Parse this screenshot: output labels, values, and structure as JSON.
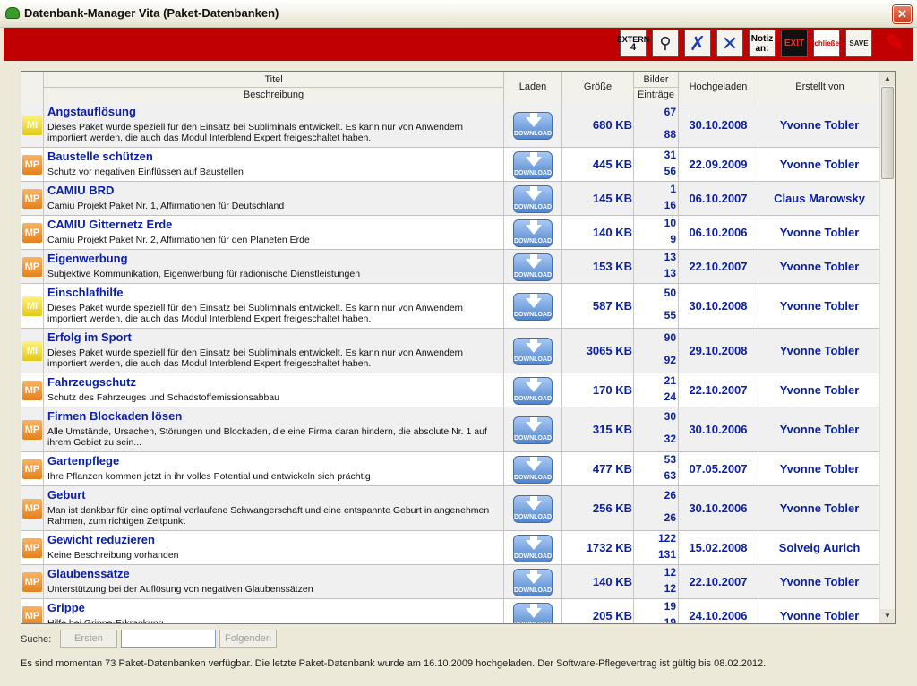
{
  "window": {
    "title": "Datenbank-Manager Vita (Paket-Datenbanken)",
    "close": "✕"
  },
  "toolbar": {
    "extern_label": "EXTERN",
    "extern_num": "4",
    "notiz_label": "Notiz an:",
    "exit_label": "EXIT",
    "schliessen_label": "Schließen",
    "save_label": "SAVE"
  },
  "columns": {
    "titel": "Titel",
    "beschreibung": "Beschreibung",
    "laden": "Laden",
    "groesse": "Größe",
    "bilder": "Bilder",
    "eintraege": "Einträge",
    "hochgeladen": "Hochgeladen",
    "erstellt_von": "Erstellt von"
  },
  "download_label": "DOWNLOAD",
  "rows": [
    {
      "badge": "MI",
      "title": "Angstauflösung",
      "desc": "Dieses Paket wurde speziell für den Einsatz bei Subliminals entwickelt. Es kann nur von Anwendern importiert werden, die auch das Modul Interblend Expert freigeschaltet haben.",
      "size": "680 KB",
      "bilder": "67",
      "eintraege": "88",
      "date": "30.10.2008",
      "author": "Yvonne Tobler"
    },
    {
      "badge": "MP",
      "title": "Baustelle schützen",
      "desc": "Schutz vor negativen Einflüssen auf Baustellen",
      "size": "445 KB",
      "bilder": "31",
      "eintraege": "56",
      "date": "22.09.2009",
      "author": "Yvonne Tobler"
    },
    {
      "badge": "MP",
      "title": "CAMIU BRD",
      "desc": "Camiu Projekt Paket Nr. 1, Affirmationen für Deutschland",
      "size": "145 KB",
      "bilder": "1",
      "eintraege": "16",
      "date": "06.10.2007",
      "author": "Claus Marowsky"
    },
    {
      "badge": "MP",
      "title": "CAMIU Gitternetz Erde",
      "desc": "Camiu Projekt Paket Nr. 2, Affirmationen für den Planeten Erde",
      "size": "140 KB",
      "bilder": "10",
      "eintraege": "9",
      "date": "06.10.2006",
      "author": "Yvonne Tobler"
    },
    {
      "badge": "MP",
      "title": "Eigenwerbung",
      "desc": "Subjektive Kommunikation, Eigenwerbung für radionische Dienstleistungen",
      "size": "153 KB",
      "bilder": "13",
      "eintraege": "13",
      "date": "22.10.2007",
      "author": "Yvonne Tobler"
    },
    {
      "badge": "MI",
      "title": "Einschlafhilfe",
      "desc": "Dieses Paket wurde speziell für den Einsatz bei Subliminals entwickelt. Es kann nur von Anwendern importiert werden, die auch das Modul Interblend Expert freigeschaltet haben.",
      "size": "587 KB",
      "bilder": "50",
      "eintraege": "55",
      "date": "30.10.2008",
      "author": "Yvonne Tobler"
    },
    {
      "badge": "MI",
      "title": "Erfolg im Sport",
      "desc": "Dieses Paket wurde speziell für den Einsatz bei Subliminals entwickelt. Es kann nur von Anwendern importiert werden, die auch das Modul Interblend Expert freigeschaltet haben.",
      "size": "3065 KB",
      "bilder": "90",
      "eintraege": "92",
      "date": "29.10.2008",
      "author": "Yvonne Tobler"
    },
    {
      "badge": "MP",
      "title": "Fahrzeugschutz",
      "desc": "Schutz des Fahrzeuges und Schadstoffemissionsabbau",
      "size": "170 KB",
      "bilder": "21",
      "eintraege": "24",
      "date": "22.10.2007",
      "author": "Yvonne Tobler"
    },
    {
      "badge": "MP",
      "title": "Firmen Blockaden lösen",
      "desc": "Alle Umstände, Ursachen, Störungen und Blockaden, die eine Firma daran hindern, die absolute Nr. 1 auf ihrem Gebiet zu sein...",
      "size": "315 KB",
      "bilder": "30",
      "eintraege": "32",
      "date": "30.10.2006",
      "author": "Yvonne Tobler"
    },
    {
      "badge": "MP",
      "title": "Gartenpflege",
      "desc": "Ihre Pflanzen kommen jetzt in ihr volles Potential und entwickeln sich prächtig",
      "size": "477 KB",
      "bilder": "53",
      "eintraege": "63",
      "date": "07.05.2007",
      "author": "Yvonne Tobler"
    },
    {
      "badge": "MP",
      "title": "Geburt",
      "desc": "Man ist dankbar für eine optimal verlaufene Schwangerschaft und eine entspannte Geburt in angenehmen Rahmen, zum richtigen Zeitpunkt",
      "size": "256 KB",
      "bilder": "26",
      "eintraege": "26",
      "date": "30.10.2006",
      "author": "Yvonne Tobler"
    },
    {
      "badge": "MP",
      "title": "Gewicht reduzieren",
      "desc": "Keine Beschreibung vorhanden",
      "size": "1732 KB",
      "bilder": "122",
      "eintraege": "131",
      "date": "15.02.2008",
      "author": "Solveig Aurich"
    },
    {
      "badge": "MP",
      "title": "Glaubenssätze",
      "desc": "Unterstützung bei der Auflösung von negativen Glaubenssätzen",
      "size": "140 KB",
      "bilder": "12",
      "eintraege": "12",
      "date": "22.10.2007",
      "author": "Yvonne Tobler"
    },
    {
      "badge": "MP",
      "title": "Grippe",
      "desc": "Hilfe bei Grippe-Erkrankung",
      "size": "205 KB",
      "bilder": "19",
      "eintraege": "19",
      "date": "24.10.2006",
      "author": "Yvonne Tobler"
    }
  ],
  "search": {
    "label": "Suche:",
    "first_btn": "Ersten",
    "next_btn": "Folgenden",
    "value": ""
  },
  "status_text": "Es sind momentan 73 Paket-Datenbanken verfügbar. Die letzte Paket-Datenbank wurde am 16.10.2009 hochgeladen. Der Software-Pflegevertrag ist gültig bis 08.02.2012."
}
